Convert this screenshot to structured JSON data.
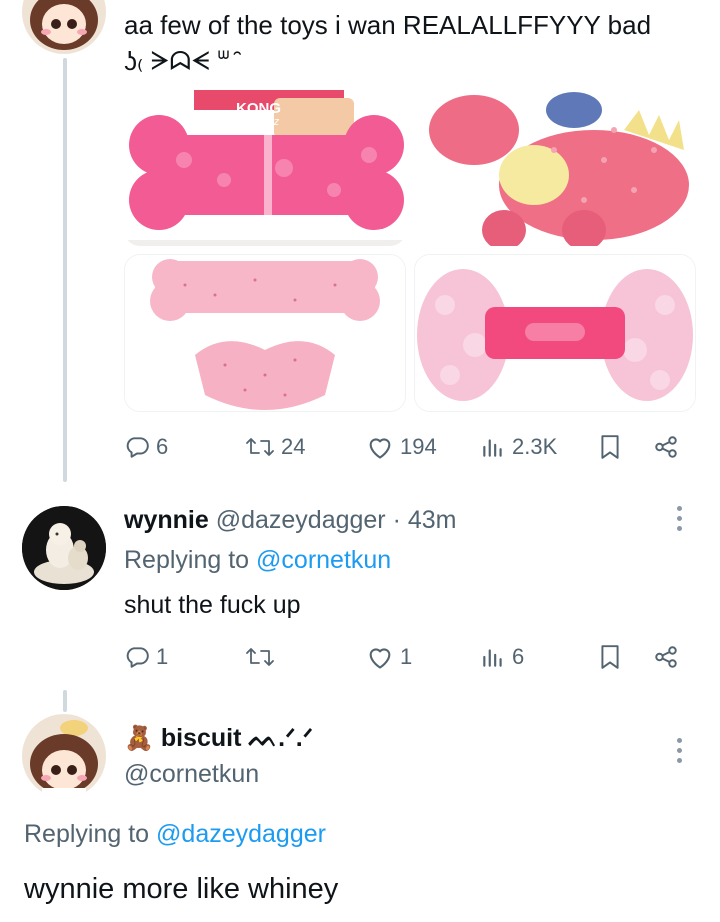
{
  "post1": {
    "text_line1": "aa few of the toys i wan REALALLFFYYY bad",
    "text_line2": "ʖ₍ ᗒᗣᗕ ᐜ ̑",
    "image_labels": {
      "brand": "KONG",
      "sub": "Squeez"
    },
    "metrics": {
      "replies": "6",
      "retweets": "24",
      "likes": "194",
      "views": "2.3K"
    }
  },
  "post2": {
    "display_name": "wynnie",
    "handle": "@dazeydagger",
    "time": "· 43m",
    "replying_prefix": "Replying to",
    "replying_to": "@cornetkun",
    "text": "shut the fuck up",
    "metrics": {
      "replies": "1",
      "retweets": "",
      "likes": "1",
      "views": "6"
    }
  },
  "post3": {
    "emoji": "🧸",
    "display_name": "biscuit ᠌ᨓ.ᐟ.ᐟ",
    "handle": "@cornetkun",
    "replying_prefix": "Replying to",
    "replying_to": "@dazeydagger",
    "text": "wynnie more like whiney"
  },
  "colors": {
    "accent": "#1d9bf0",
    "muted": "#536471",
    "pink": "#f06a97"
  }
}
